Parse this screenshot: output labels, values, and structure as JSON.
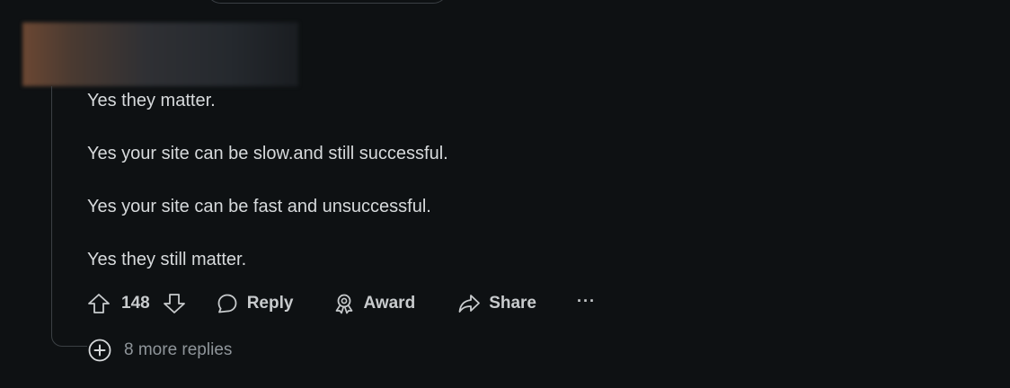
{
  "comment": {
    "paragraphs": [
      "Yes they matter.",
      "Yes your site can be slow.and still successful.",
      "Yes your site can be fast and unsuccessful.",
      "Yes they still matter."
    ],
    "vote_count": "148",
    "actions": {
      "reply": "Reply",
      "award": "Award",
      "share": "Share",
      "more": "···"
    },
    "more_replies": "8 more replies"
  },
  "icons": {
    "upvote": "arrow-up-icon",
    "downvote": "arrow-down-icon",
    "reply": "speech-bubble-icon",
    "award": "ribbon-icon",
    "share": "share-arrow-icon",
    "expand": "plus-circle-icon"
  },
  "colors": {
    "background": "#0e1113",
    "text": "#d7dadc",
    "muted": "#8f959a",
    "thread_line": "#3b4044"
  }
}
